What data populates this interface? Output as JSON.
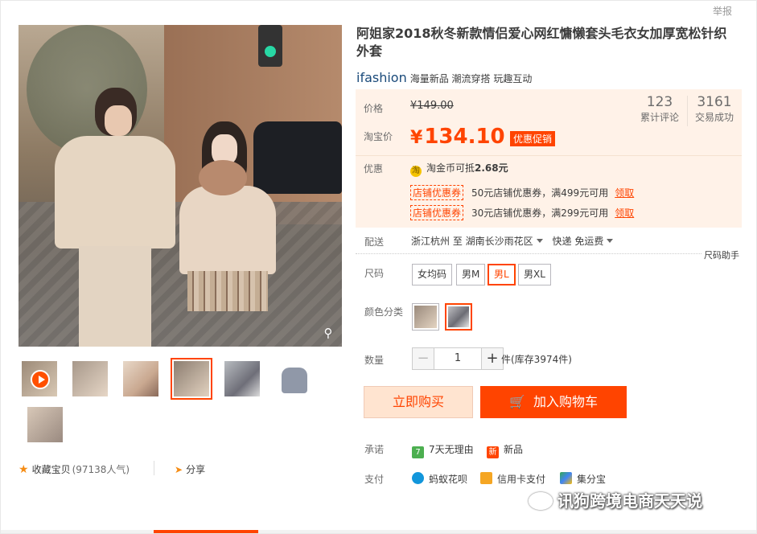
{
  "header": {
    "report": "举报"
  },
  "product": {
    "title": "阿姐家2018秋冬新款情侣爱心网红慵懒套头毛衣女加厚宽松针织外套",
    "brand_logo": "ifashion",
    "brand_tags": "海量新品 潮流穿搭 玩趣互动"
  },
  "price": {
    "label": "价格",
    "original": "¥149.00",
    "taobao_label": "淘宝价",
    "yen": "¥",
    "current": "134.10",
    "promo_badge": "优惠促销"
  },
  "stats": [
    {
      "num": "123",
      "cap": "累计评论"
    },
    {
      "num": "3161",
      "cap": "交易成功"
    }
  ],
  "discount": {
    "label": "优惠",
    "coin_text": "淘金币可抵",
    "coin_amount": "2.68元",
    "coupons": [
      {
        "tag": "店铺优惠券",
        "desc": "50元店铺优惠券，满499元可用",
        "action": "领取"
      },
      {
        "tag": "店铺优惠券",
        "desc": "30元店铺优惠券，满299元可用",
        "action": "领取"
      }
    ]
  },
  "delivery": {
    "label": "配送",
    "from": "浙江杭州 至",
    "to": "湖南长沙雨花区",
    "method": "快递 免运费"
  },
  "size": {
    "label": "尺码",
    "help": "尺码助手",
    "options": [
      "女均码",
      "男M",
      "男L",
      "男XL"
    ],
    "selected": "男L"
  },
  "color": {
    "label": "颜色分类"
  },
  "quantity": {
    "label": "数量",
    "minus": "−",
    "value": "1",
    "plus": "+",
    "stock": "件(库存3974件)"
  },
  "actions": {
    "buy": "立即购买",
    "cart": "加入购物车"
  },
  "promise": {
    "label": "承诺",
    "items": [
      {
        "icon": "7",
        "text": "7天无理由",
        "color": "#4caf50"
      },
      {
        "icon": "新",
        "text": "新品",
        "color": "#f40"
      }
    ]
  },
  "payment": {
    "label": "支付",
    "items": [
      {
        "text": "蚂蚁花呗",
        "color": "#1296db"
      },
      {
        "text": "信用卡支付",
        "color": "#f5a623"
      },
      {
        "text": "集分宝",
        "color": "#34a853"
      }
    ]
  },
  "social": {
    "favorite": "收藏宝贝",
    "popularity": "(97138人气)",
    "share": "分享"
  },
  "watermark": "讯狗跨境电商天天说",
  "colors": {
    "accent": "#ff4400",
    "price_bg": "#fff2e8"
  }
}
